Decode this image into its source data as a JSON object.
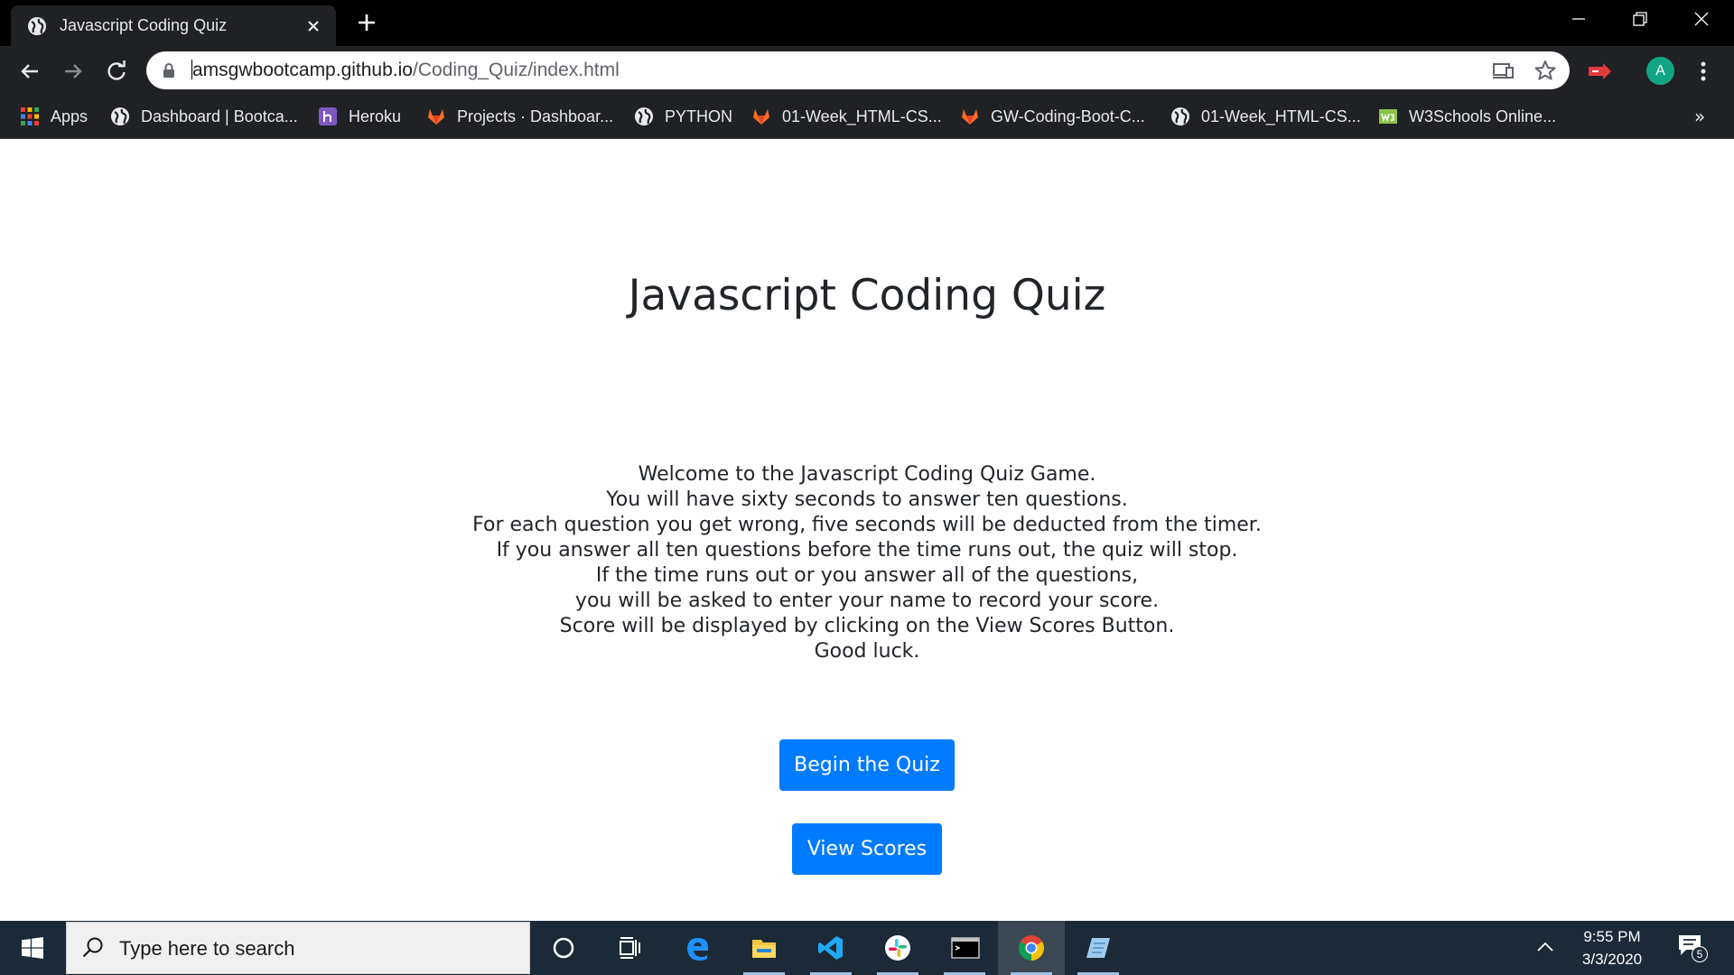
{
  "browser": {
    "tab_title": "Javascript Coding Quiz",
    "url_host": "amsgwbootcamp.github.io",
    "url_path": "/Coding_Quiz/index.html",
    "profile_initial": "A"
  },
  "bookmarks": [
    {
      "label": "Apps",
      "icon": "apps-grid-icon"
    },
    {
      "label": "Dashboard | Bootca...",
      "icon": "globe-icon"
    },
    {
      "label": "Heroku",
      "icon": "heroku-icon"
    },
    {
      "label": "Projects · Dashboar...",
      "icon": "gitlab-icon"
    },
    {
      "label": "PYTHON",
      "icon": "globe-icon"
    },
    {
      "label": "01-Week_HTML-CS...",
      "icon": "gitlab-icon"
    },
    {
      "label": "GW-Coding-Boot-C...",
      "icon": "gitlab-icon"
    },
    {
      "label": "01-Week_HTML-CS...",
      "icon": "globe-icon"
    },
    {
      "label": "W3Schools Online...",
      "icon": "w3schools-icon"
    }
  ],
  "bookmarks_overflow": "»",
  "page": {
    "title": "Javascript Coding Quiz",
    "instructions": [
      "Welcome to the Javascript Coding Quiz Game.",
      "You will have sixty seconds to answer ten questions.",
      "For each question you get wrong, five seconds will be deducted from the timer.",
      "If you answer all ten questions before the time runs out, the quiz will stop.",
      "If the time runs out or you answer all of the questions,",
      "you will be asked to enter your name to record your score.",
      "Score will be displayed by clicking on the View Scores Button.",
      "Good luck."
    ],
    "begin_button": "Begin the Quiz",
    "scores_button": "View Scores",
    "button_color": "#007bff"
  },
  "taskbar": {
    "search_placeholder": "Type here to search",
    "time": "9:55 PM",
    "date": "3/3/2020",
    "notification_count": "5",
    "apps": [
      "cortana-icon",
      "task-view-icon",
      "edge-icon",
      "file-explorer-icon",
      "vscode-icon",
      "slack-icon",
      "terminal-icon",
      "chrome-icon",
      "notepad-icon"
    ]
  }
}
